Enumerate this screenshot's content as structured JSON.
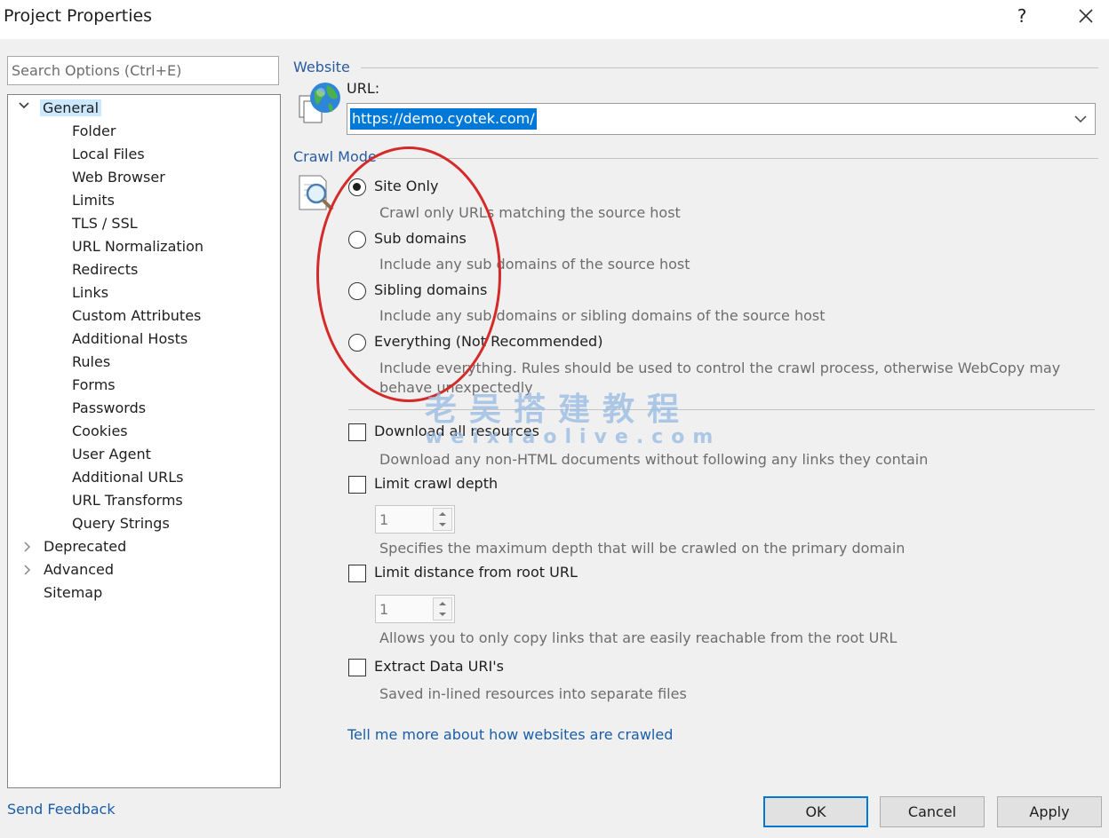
{
  "window": {
    "title": "Project Properties",
    "help_label": "?"
  },
  "search": {
    "placeholder": "Search Options (Ctrl+E)"
  },
  "tree": {
    "general": "General",
    "general_children": [
      "Folder",
      "Local Files",
      "Web Browser",
      "Limits",
      "TLS / SSL",
      "URL Normalization",
      "Redirects",
      "Links",
      "Custom Attributes",
      "Additional Hosts",
      "Rules",
      "Forms",
      "Passwords",
      "Cookies",
      "User Agent",
      "Additional URLs",
      "URL Transforms",
      "Query Strings"
    ],
    "deprecated": "Deprecated",
    "advanced": "Advanced",
    "sitemap": "Sitemap"
  },
  "feedback_label": "Send Feedback",
  "website": {
    "group_label": "Website",
    "url_label": "URL:",
    "url_value": "https://demo.cyotek.com/"
  },
  "crawl_mode": {
    "group_label": "Crawl Mode",
    "selected": "site_only",
    "site_only": {
      "label": "Site Only",
      "desc": "Crawl only URLs matching the source host"
    },
    "sub_domains": {
      "label": "Sub domains",
      "desc": "Include any sub domains of the source host"
    },
    "sibling_domains": {
      "label": "Sibling domains",
      "desc": "Include any sub domains or sibling domains of the source host"
    },
    "everything": {
      "label": "Everything (Not Recommended)",
      "desc_line1": "Include everything. Rules should be used to control the crawl process, otherwise WebCopy may",
      "desc_line2": "behave unexpectedly"
    }
  },
  "options": {
    "download_all": {
      "label": "Download all resources",
      "desc": "Download any non-HTML documents without following any links they contain",
      "checked": false
    },
    "limit_depth": {
      "label": "Limit crawl depth",
      "value": "1",
      "desc": "Specifies the maximum depth that will be crawled on the primary domain",
      "checked": false
    },
    "limit_distance": {
      "label": "Limit distance from root URL",
      "value": "1",
      "desc": "Allows you to only copy links that are easily reachable from the root URL",
      "checked": false
    },
    "extract_data": {
      "label": "Extract Data URI's",
      "desc": "Saved in-lined resources into separate files",
      "checked": false
    }
  },
  "help_link": "Tell me more about how websites are crawled",
  "buttons": {
    "ok": "OK",
    "cancel": "Cancel",
    "apply": "Apply"
  },
  "watermark": {
    "line1": "老吴搭建教程",
    "line2": "weixiaolive.com"
  },
  "colors": {
    "accent": "#0078d7",
    "link": "#1a5ea8",
    "group_label": "#2a5aa0",
    "annotation": "#d42a2a"
  },
  "icons": {
    "website_group": "globe-pages-icon",
    "crawl_mode_group": "document-magnifier-icon"
  }
}
